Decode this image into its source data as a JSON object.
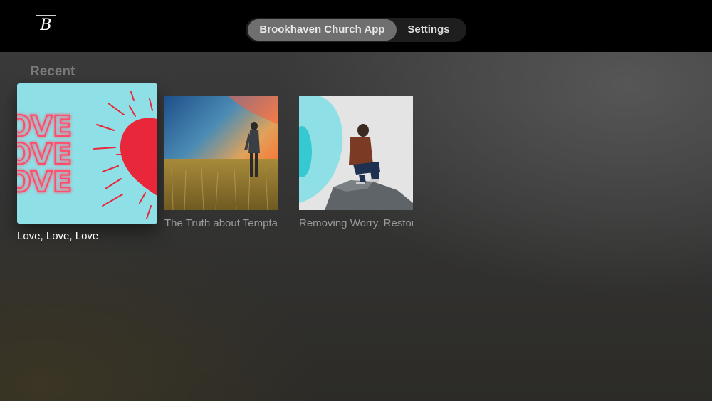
{
  "header": {
    "logo_letter": "B",
    "tabs": [
      {
        "label": "Brookhaven Church App",
        "active": true
      },
      {
        "label": "Settings",
        "active": false
      }
    ]
  },
  "section": {
    "title": "Recent"
  },
  "items": [
    {
      "title": "Love, Love, Love",
      "focused": true,
      "art_text": "OVE",
      "icon": "heart-artwork"
    },
    {
      "title": "The Truth about Temptation",
      "focused": false,
      "icon": "wheat-field-sunset-artwork"
    },
    {
      "title": "Removing Worry, Restoring Peace",
      "focused": false,
      "icon": "man-on-rock-artwork"
    }
  ],
  "colors": {
    "topbar": "#000000",
    "active_tab": "#6f6f6f",
    "love_art_bg": "#8ee0e6",
    "heart": "#e8283a",
    "neon_text": "#ff4d6a"
  }
}
